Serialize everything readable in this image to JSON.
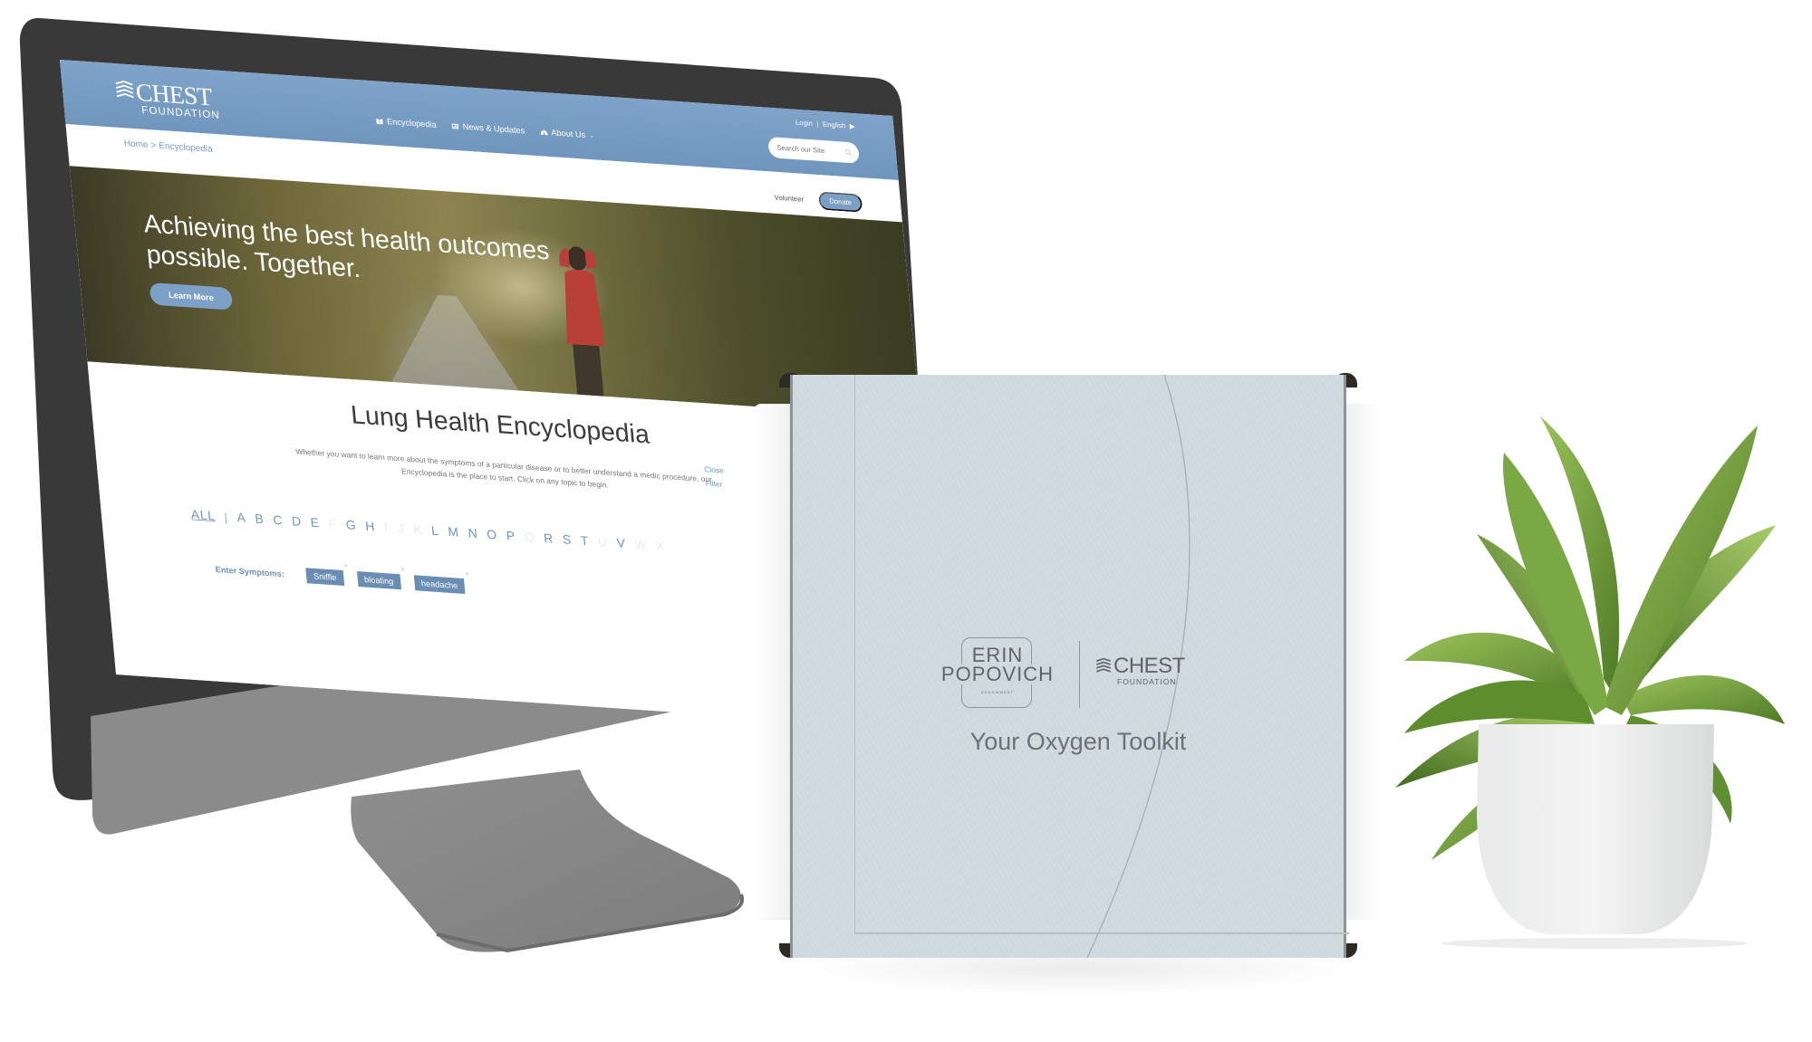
{
  "scene": {
    "description": "Product mockup: desktop monitor showing CHEST Foundation website beside an oxygen toolkit box and a potted plant"
  },
  "website": {
    "logo": {
      "name": "CHEST",
      "registered": "®",
      "subtitle": "FOUNDATION"
    },
    "top_links": {
      "login": "Login",
      "separator": "|",
      "language": "English"
    },
    "nav": [
      {
        "label": "Encyclopedia",
        "icon": "book-icon"
      },
      {
        "label": "News & Updates",
        "icon": "newspaper-icon"
      },
      {
        "label": "About Us",
        "icon": "lungs-icon",
        "has_dropdown": true
      }
    ],
    "search": {
      "placeholder": "Search our Site",
      "value": ""
    },
    "breadcrumb": [
      "Home",
      ">",
      "Encyclopedia"
    ],
    "volunteer_label": "Volunteer",
    "donate_label": "Donate",
    "hero": {
      "title_line1": "Achieving the best health outcomes",
      "title_line2": "possible. Together.",
      "cta_label": "Learn More"
    },
    "encyclopedia": {
      "title": "Lung Health Encyclopedia",
      "description": "Whether you want to learn more about the symptoms of a particular disease or to better understand a medic procedure, our Encyclopedia is the place to start. Click on any topic to begin.",
      "side_links": [
        "Close",
        "Filter"
      ],
      "alphabet_all": "ALL",
      "alphabet": [
        {
          "letter": "A",
          "enabled": true
        },
        {
          "letter": "B",
          "enabled": true
        },
        {
          "letter": "C",
          "enabled": true
        },
        {
          "letter": "D",
          "enabled": true
        },
        {
          "letter": "E",
          "enabled": true
        },
        {
          "letter": "F",
          "enabled": false
        },
        {
          "letter": "G",
          "enabled": true
        },
        {
          "letter": "H",
          "enabled": true
        },
        {
          "letter": "I",
          "enabled": false
        },
        {
          "letter": "J",
          "enabled": false
        },
        {
          "letter": "K",
          "enabled": false
        },
        {
          "letter": "L",
          "enabled": true
        },
        {
          "letter": "M",
          "enabled": true
        },
        {
          "letter": "N",
          "enabled": true
        },
        {
          "letter": "O",
          "enabled": true
        },
        {
          "letter": "P",
          "enabled": true
        },
        {
          "letter": "Q",
          "enabled": false
        },
        {
          "letter": "R",
          "enabled": true
        },
        {
          "letter": "S",
          "enabled": true
        },
        {
          "letter": "T",
          "enabled": true
        },
        {
          "letter": "U",
          "enabled": false
        },
        {
          "letter": "V",
          "enabled": true
        },
        {
          "letter": "W",
          "enabled": false
        },
        {
          "letter": "X",
          "enabled": false
        }
      ],
      "symptoms_label": "Enter Symptoms:",
      "symptom_chips": [
        "Sniffle",
        "bloating",
        "headache"
      ],
      "chip_remove_glyph": "×"
    }
  },
  "box": {
    "brand_left_line1": "ERIN",
    "brand_left_line2": "POPOVICH",
    "brand_left_line3": "ENDOWMENT",
    "brand_right_name": "CHEST",
    "brand_right_subtitle": "FOUNDATION",
    "product_title": "Your Oxygen Toolkit"
  },
  "colors": {
    "header_blue": "#7599c0",
    "accent_blue": "#7a9ec4",
    "link_blue": "#7095bd",
    "chip_blue": "#6a8db3",
    "bezel": "#383838",
    "chin": "#8a8a8a",
    "box_face": "#ced9dd",
    "plant_green": "#6d9a3c"
  }
}
